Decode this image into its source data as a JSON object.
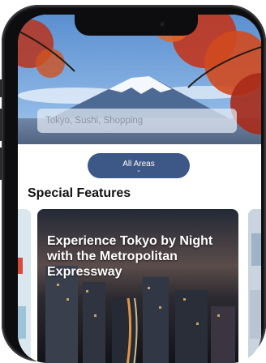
{
  "search": {
    "placeholder": "Tokyo, Sushi, Shopping"
  },
  "area_selector": {
    "label": "All Areas",
    "chevron": "⌄"
  },
  "section": {
    "title": "Special Features"
  },
  "cards": [
    {
      "title": "Experience Tokyo by Night with the Metropolitan Expressway"
    }
  ],
  "colors": {
    "accent": "#3d5786",
    "text": "#111111"
  },
  "icons": {
    "chevron": "chevron-down-icon"
  }
}
